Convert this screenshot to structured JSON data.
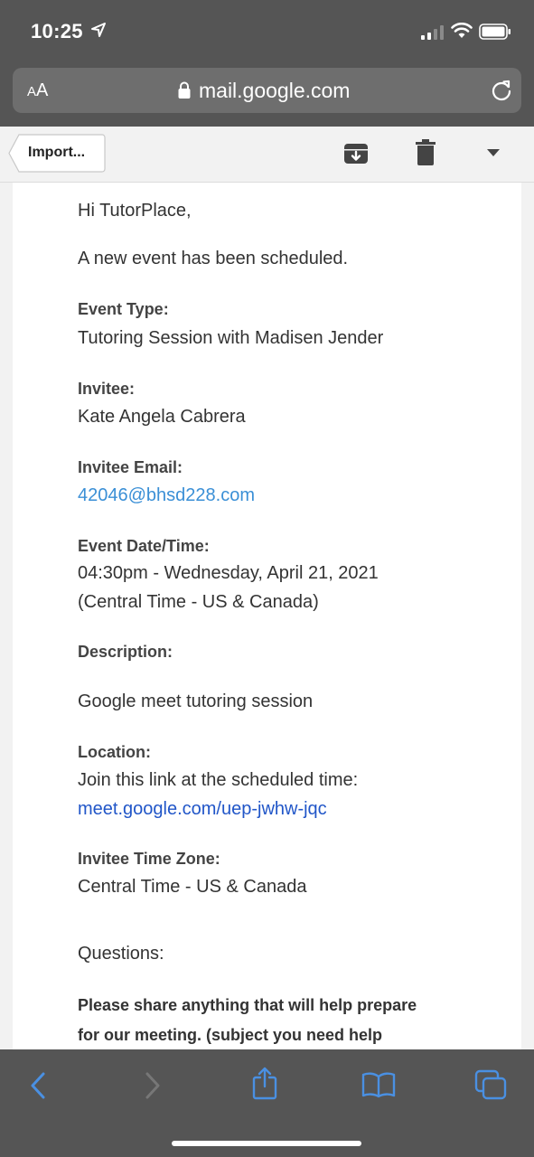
{
  "status_bar": {
    "time": "10:25"
  },
  "browser": {
    "aa_label_small": "A",
    "aa_label_large": "A",
    "url": "mail.google.com"
  },
  "toolbar": {
    "back_label": "Import..."
  },
  "email": {
    "greeting": "Hi TutorPlace,",
    "intro": "A new event has been scheduled.",
    "event_type_label": "Event Type:",
    "event_type_value": "Tutoring Session with Madisen Jender",
    "invitee_label": "Invitee:",
    "invitee_value": "Kate Angela Cabrera",
    "invitee_email_label": "Invitee Email:",
    "invitee_email_value": "42046@bhsd228.com",
    "event_datetime_label": "Event Date/Time:",
    "event_datetime_line1": "04:30pm - Wednesday, April 21, 2021",
    "event_datetime_line2": "(Central Time - US & Canada)",
    "description_label": "Description:",
    "description_value": "Google meet tutoring session",
    "location_label": "Location:",
    "location_line1": "Join this link at the scheduled time:",
    "location_link": "meet.google.com/uep-jwhw-jqc",
    "timezone_label": "Invitee Time Zone:",
    "timezone_value": "Central Time - US & Canada",
    "questions_label": "Questions:",
    "question_line1": "Please share anything that will help prepare",
    "question_line2": "for our meeting. (subject you need help"
  },
  "colors": {
    "chrome": "#555555",
    "link_blue": "#3a8fd6",
    "meet_link": "#2156c8",
    "safari_blue": "#4a90e2"
  },
  "icons": [
    "location-arrow-icon",
    "signal-icon",
    "wifi-icon",
    "battery-icon",
    "lock-icon",
    "reload-icon",
    "archive-icon",
    "trash-icon",
    "chevron-down-icon",
    "back-arrow-icon",
    "forward-arrow-icon",
    "share-icon",
    "bookmarks-icon",
    "tabs-icon"
  ]
}
